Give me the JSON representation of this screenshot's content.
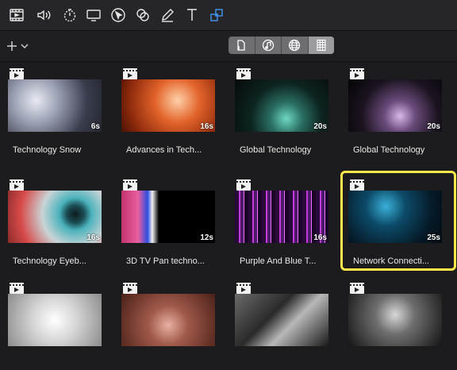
{
  "toolbar": {
    "tools": [
      {
        "icon": "film-icon"
      },
      {
        "icon": "speaker-icon"
      },
      {
        "icon": "timer-icon"
      },
      {
        "icon": "monitor-icon"
      },
      {
        "icon": "cursor-icon"
      },
      {
        "icon": "shapes-icon"
      },
      {
        "icon": "pen-icon"
      },
      {
        "icon": "text-icon"
      },
      {
        "icon": "transition-icon",
        "active": true
      }
    ],
    "accent": "#3f8fe6"
  },
  "subbar": {
    "add_label": "+",
    "segments": [
      {
        "icon": "document-icon"
      },
      {
        "icon": "music-icon"
      },
      {
        "icon": "globe-icon"
      },
      {
        "icon": "grid-icon",
        "active": true
      }
    ]
  },
  "media": [
    {
      "title": "Technology Snow",
      "duration": "6s"
    },
    {
      "title": "Advances in Tech...",
      "duration": "16s"
    },
    {
      "title": "Global Technology",
      "duration": "20s"
    },
    {
      "title": "Global Technology",
      "duration": "20s"
    },
    {
      "title": "Technology Eyeb...",
      "duration": "16s"
    },
    {
      "title": "3D TV Pan techno...",
      "duration": "12s"
    },
    {
      "title": "Purple And Blue T...",
      "duration": "16s"
    },
    {
      "title": "Network Connecti...",
      "duration": "25s",
      "selected": true
    },
    {
      "title": "",
      "duration": ""
    },
    {
      "title": "",
      "duration": ""
    },
    {
      "title": "",
      "duration": ""
    },
    {
      "title": "",
      "duration": ""
    }
  ],
  "selection_color": "#ffe94a"
}
